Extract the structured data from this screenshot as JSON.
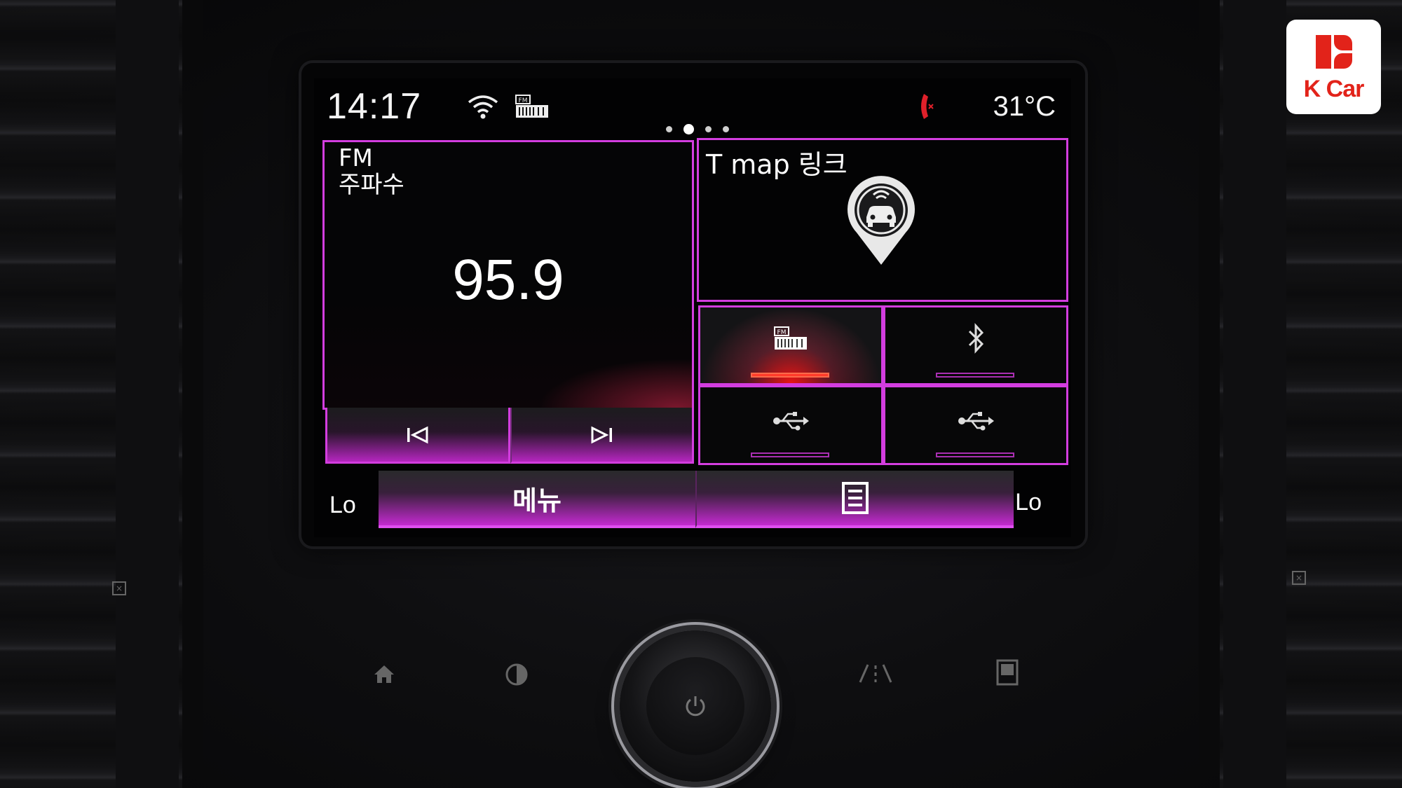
{
  "status_bar": {
    "time": "14:17",
    "temperature": "31°C",
    "icons": [
      "wifi-icon",
      "fm-radio-icon",
      "phone-missed-icon"
    ],
    "page_count": 4,
    "active_page": 2
  },
  "fm_widget": {
    "band": "FM",
    "label": "주파수",
    "frequency": "95.9",
    "prev_icon": "previous-track-icon",
    "next_icon": "next-track-icon"
  },
  "tmap_widget": {
    "title": "T map 링크",
    "icon": "tmap-car-pin-icon"
  },
  "sources": [
    {
      "name": "fm",
      "icon": "fm-radio-icon",
      "active": true
    },
    {
      "name": "bluetooth",
      "icon": "bluetooth-icon",
      "active": false
    },
    {
      "name": "usb-1",
      "icon": "usb-icon",
      "active": false
    },
    {
      "name": "usb-2",
      "icon": "usb-icon",
      "active": false
    }
  ],
  "bottom_bar": {
    "menu_label": "메뉴",
    "list_icon": "list-icon",
    "left_climate": "Lo",
    "right_climate": "Lo"
  },
  "hardware_buttons": [
    "home-icon",
    "brightness-icon",
    "lane-assist-icon",
    "display-off-icon",
    "power-icon"
  ],
  "brand": {
    "logo": "K Car"
  },
  "colors": {
    "accent": "#d33ddf",
    "active_source": "#ff2a2a",
    "phone_icon": "#e0202a"
  }
}
